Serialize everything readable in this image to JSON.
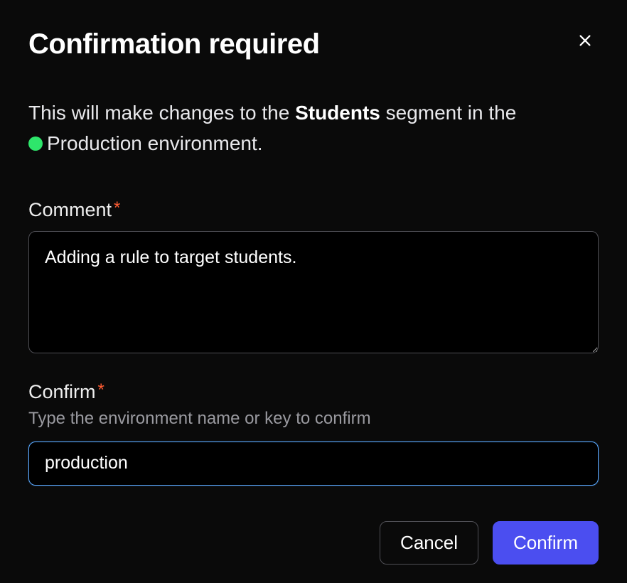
{
  "modal": {
    "title": "Confirmation required",
    "close_icon": "close-icon",
    "description": {
      "prefix": "This will make changes to the ",
      "segment_name": "Students",
      "segment_suffix": " segment in the ",
      "env_name": "Production",
      "env_suffix": " environment.",
      "env_dot_color": "#2ee66b"
    },
    "comment": {
      "label": "Comment",
      "required": true,
      "value": "Adding a rule to target students."
    },
    "confirm_field": {
      "label": "Confirm",
      "required": true,
      "hint": "Type the environment name or key to confirm",
      "value": "production"
    },
    "buttons": {
      "cancel": "Cancel",
      "confirm": "Confirm"
    },
    "colors": {
      "accent": "#4b4ef0",
      "focus_border": "#5aa9ff",
      "required_star": "#ff5c33"
    }
  }
}
